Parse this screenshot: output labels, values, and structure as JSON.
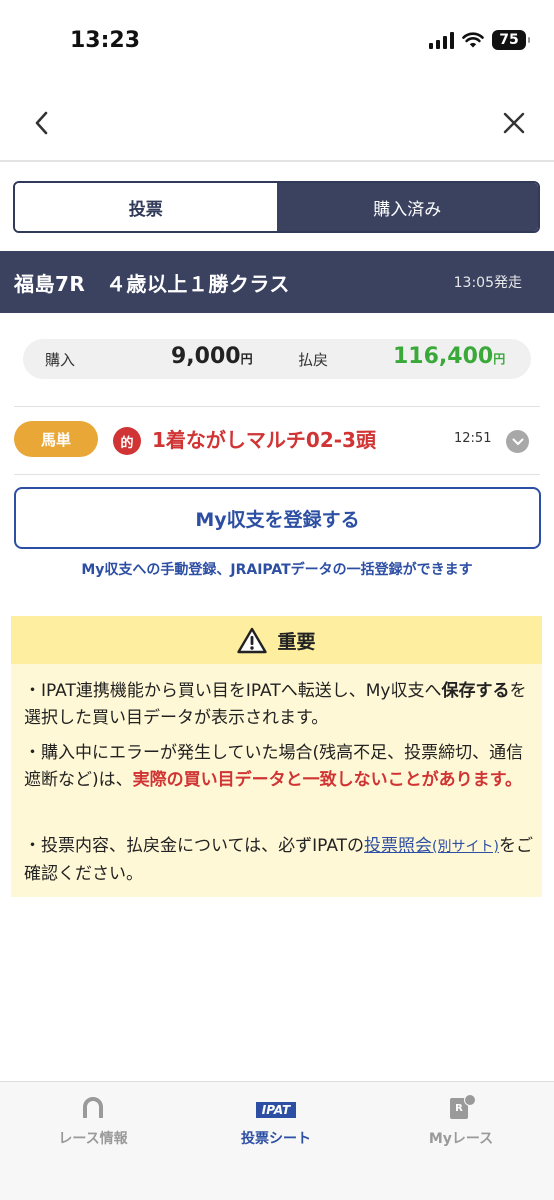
{
  "status_bar": {
    "time": "13:23",
    "battery": "75"
  },
  "header": {
    "back_icon": "chevron-left-icon",
    "close_icon": "close-icon"
  },
  "tabs": {
    "vote": "投票",
    "purchased": "購入済み",
    "active": "vote"
  },
  "race": {
    "title": "福島7R　４歳以上１勝クラス",
    "start_time": "13:05発走"
  },
  "summary": {
    "purchase_label": "購入",
    "purchase_amount": "9,000",
    "purchase_unit": "円",
    "payout_label": "払戻",
    "payout_amount": "116,400",
    "payout_unit": "円",
    "payout_color": "#3aa93a"
  },
  "ticket": {
    "bet_type": "馬単",
    "hit_badge": "的",
    "description": "1着ながしマルチ02-3頭",
    "time": "12:51"
  },
  "my_balance": {
    "button_label": "My収支を登録する",
    "note": "My収支への手動登録、JRAIPATデータの一括登録ができます"
  },
  "important": {
    "icon": "warning-icon",
    "title": "重要",
    "p1_a": "・IPAT連携機能から買い目をIPATへ転送し、My収支へ",
    "p1_b": "保存する",
    "p1_c": "を選択した買い目データが表示されます。",
    "p2_a": "・購入中にエラーが発生していた場合(残高不足、投票締切、通信遮断など)は、",
    "p2_b": "実際の買い目データと一致しないことがあります。",
    "p3_a": "・投票内容、払戻金については、必ずIPATの",
    "p3_link": "投票照会",
    "p3_link2": "(別サイト)",
    "p3_b": "をご確認ください。"
  },
  "bottom_nav": [
    {
      "label": "レース情報",
      "icon": "horseshoe-icon",
      "active": false
    },
    {
      "label": "投票シート",
      "icon": "ipat-icon",
      "icon_text": "IPAT",
      "active": true
    },
    {
      "label": "Myレース",
      "icon": "my-race-icon",
      "icon_text": "R",
      "active": false
    }
  ],
  "colors": {
    "navy": "#3a4260",
    "blue": "#2d4fa3",
    "red": "#d03434",
    "orange": "#e9a738"
  }
}
